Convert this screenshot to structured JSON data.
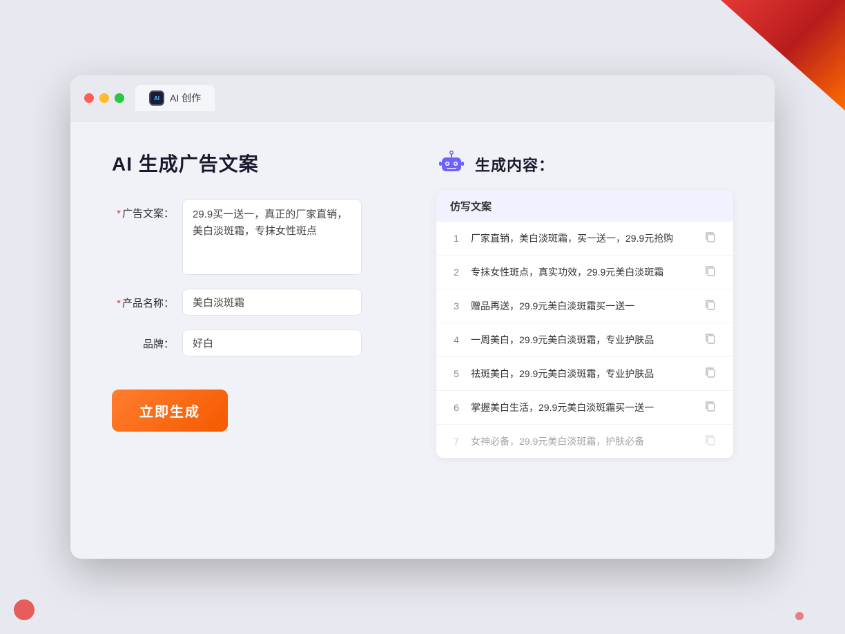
{
  "browser": {
    "tab_label": "AI 创作",
    "controls": {
      "close": "close",
      "minimize": "minimize",
      "maximize": "maximize"
    }
  },
  "left": {
    "title": "AI 生成广告文案",
    "form": {
      "ad_copy_label": "广告文案：",
      "ad_copy_required": "*",
      "ad_copy_value": "29.9买一送一，真正的厂家直销，美白淡斑霜，专抹女性斑点",
      "product_name_label": "产品名称：",
      "product_name_required": "*",
      "product_name_value": "美白淡斑霜",
      "brand_label": "品牌：",
      "brand_value": "好白",
      "generate_button": "立即生成"
    }
  },
  "right": {
    "title": "生成内容：",
    "table_header": "仿写文案",
    "results": [
      {
        "num": "1",
        "text": "厂家直销，美白淡斑霜，买一送一，29.9元抢购",
        "faded": false
      },
      {
        "num": "2",
        "text": "专抹女性斑点，真实功效，29.9元美白淡斑霜",
        "faded": false
      },
      {
        "num": "3",
        "text": "赠品再送，29.9元美白淡斑霜买一送一",
        "faded": false
      },
      {
        "num": "4",
        "text": "一周美白，29.9元美白淡斑霜，专业护肤品",
        "faded": false
      },
      {
        "num": "5",
        "text": "祛斑美白，29.9元美白淡斑霜，专业护肤品",
        "faded": false
      },
      {
        "num": "6",
        "text": "掌握美白生活，29.9元美白淡斑霜买一送一",
        "faded": false
      },
      {
        "num": "7",
        "text": "女神必备，29.9元美白淡斑霜，护肤必备",
        "faded": true
      }
    ]
  }
}
